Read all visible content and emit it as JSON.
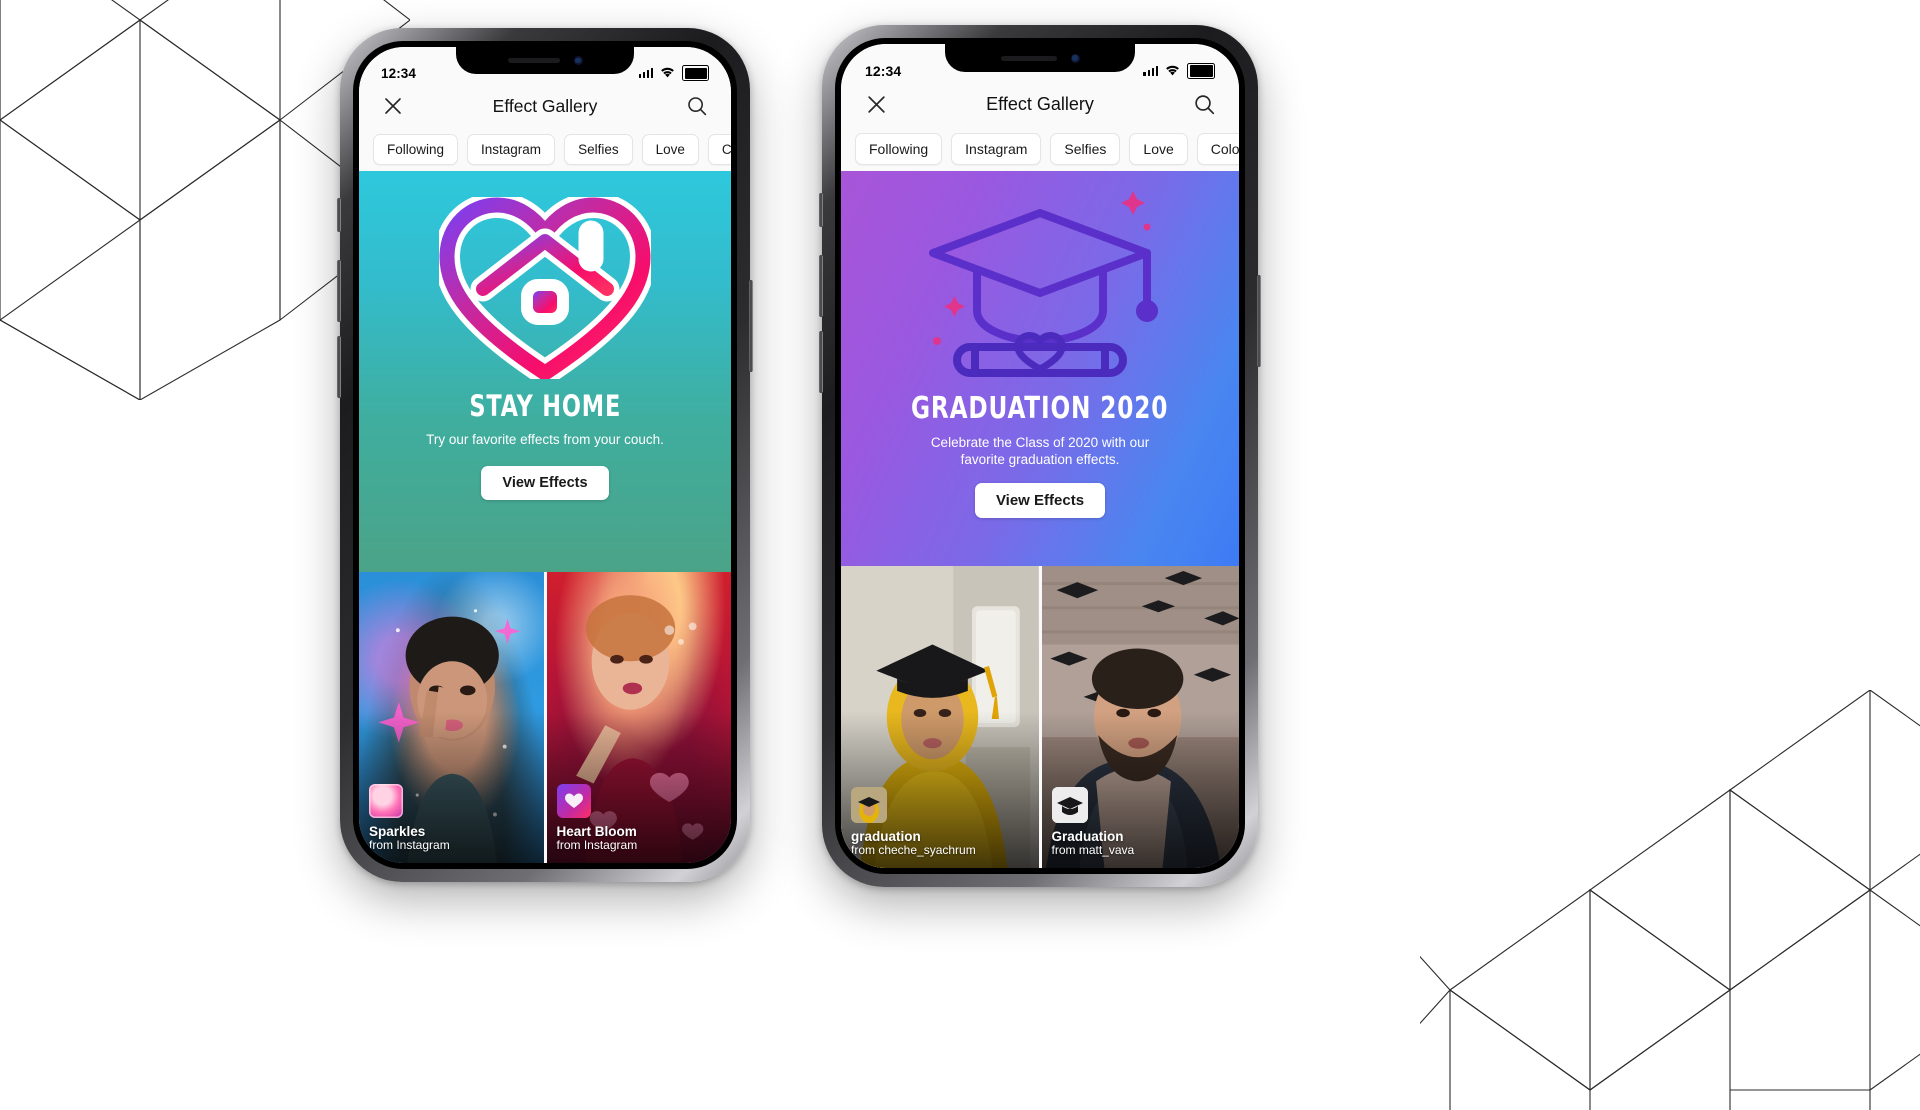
{
  "phones": [
    {
      "id": "phone-left",
      "status": {
        "time": "12:34"
      },
      "nav": {
        "title": "Effect Gallery",
        "close_icon": "close-icon",
        "search_icon": "search-icon"
      },
      "chips": [
        "Following",
        "Instagram",
        "Selfies",
        "Love",
        "Color &"
      ],
      "hero": {
        "title": "STAY HOME",
        "subtitle": "Try our favorite effects from your couch.",
        "button": "View Effects",
        "gradient_from": "#2ec8dd",
        "gradient_to": "#4b9e84",
        "art": "stay-home-heart-house-icon"
      },
      "effects": [
        {
          "name": "Sparkles",
          "author": "from Instagram",
          "thumb": "sparkles-thumb"
        },
        {
          "name": "Heart Bloom",
          "author": "from Instagram",
          "thumb": "heart-bloom-thumb"
        }
      ]
    },
    {
      "id": "phone-right",
      "status": {
        "time": "12:34"
      },
      "nav": {
        "title": "Effect Gallery",
        "close_icon": "close-icon",
        "search_icon": "search-icon"
      },
      "chips": [
        "Following",
        "Instagram",
        "Selfies",
        "Love",
        "Color"
      ],
      "hero": {
        "title": "GRADUATION 2020",
        "subtitle": "Celebrate the Class of 2020 with our favorite graduation effects.",
        "button": "View Effects",
        "gradient_from": "#a855d8",
        "gradient_to": "#3d7bf5",
        "art": "graduation-cap-diploma-icon"
      },
      "effects": [
        {
          "name": "graduation",
          "author": "from cheche_syachrum",
          "thumb": "graduation-thumb"
        },
        {
          "name": "Graduation",
          "author": "from matt_vava",
          "thumb": "graduation2-thumb"
        }
      ]
    }
  ],
  "colors": {
    "background": "#ffffff",
    "deco_line": "#2b2b2b",
    "screen_bg": "#fafafa",
    "chip_bg": "#ffffff",
    "chip_border": "#e4e4e6",
    "text_primary": "#111111"
  }
}
